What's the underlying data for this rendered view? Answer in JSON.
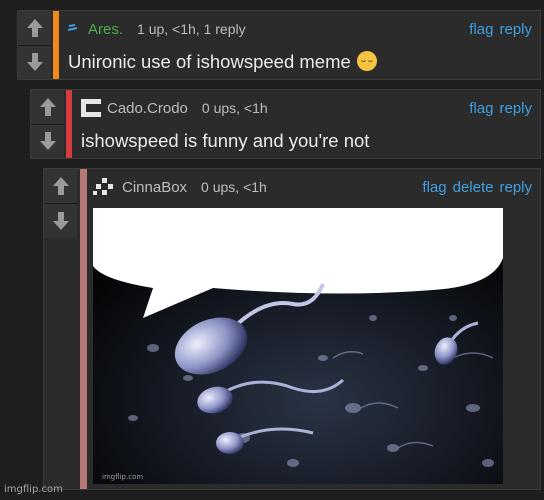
{
  "comments": [
    {
      "username": "Ares.",
      "meta": "1 up, <1h, 1 reply",
      "text": "Unironic use of ishowspeed meme",
      "emoji": "pensive-face",
      "actions": [
        "flag",
        "reply"
      ],
      "accent_color": "#f08a1c"
    },
    {
      "username": "Cado.Crodo",
      "meta": "0 ups, <1h",
      "text": "ishowspeed is funny and you're not",
      "actions": [
        "flag",
        "reply"
      ],
      "accent_color": "#d23c3c"
    },
    {
      "username": "CinnaBox",
      "meta": "0 ups, <1h",
      "actions": [
        "flag",
        "delete",
        "reply"
      ],
      "accent_color": "#b97878",
      "image_watermark": "imgflip.com"
    }
  ],
  "footer": "imgflip.com",
  "colors": {
    "link": "#3ea0e0",
    "background": "#1e1e1e",
    "panel": "#2b2b2b"
  },
  "icons": {
    "upvote": "arrow-up-icon",
    "downvote": "arrow-down-icon"
  }
}
